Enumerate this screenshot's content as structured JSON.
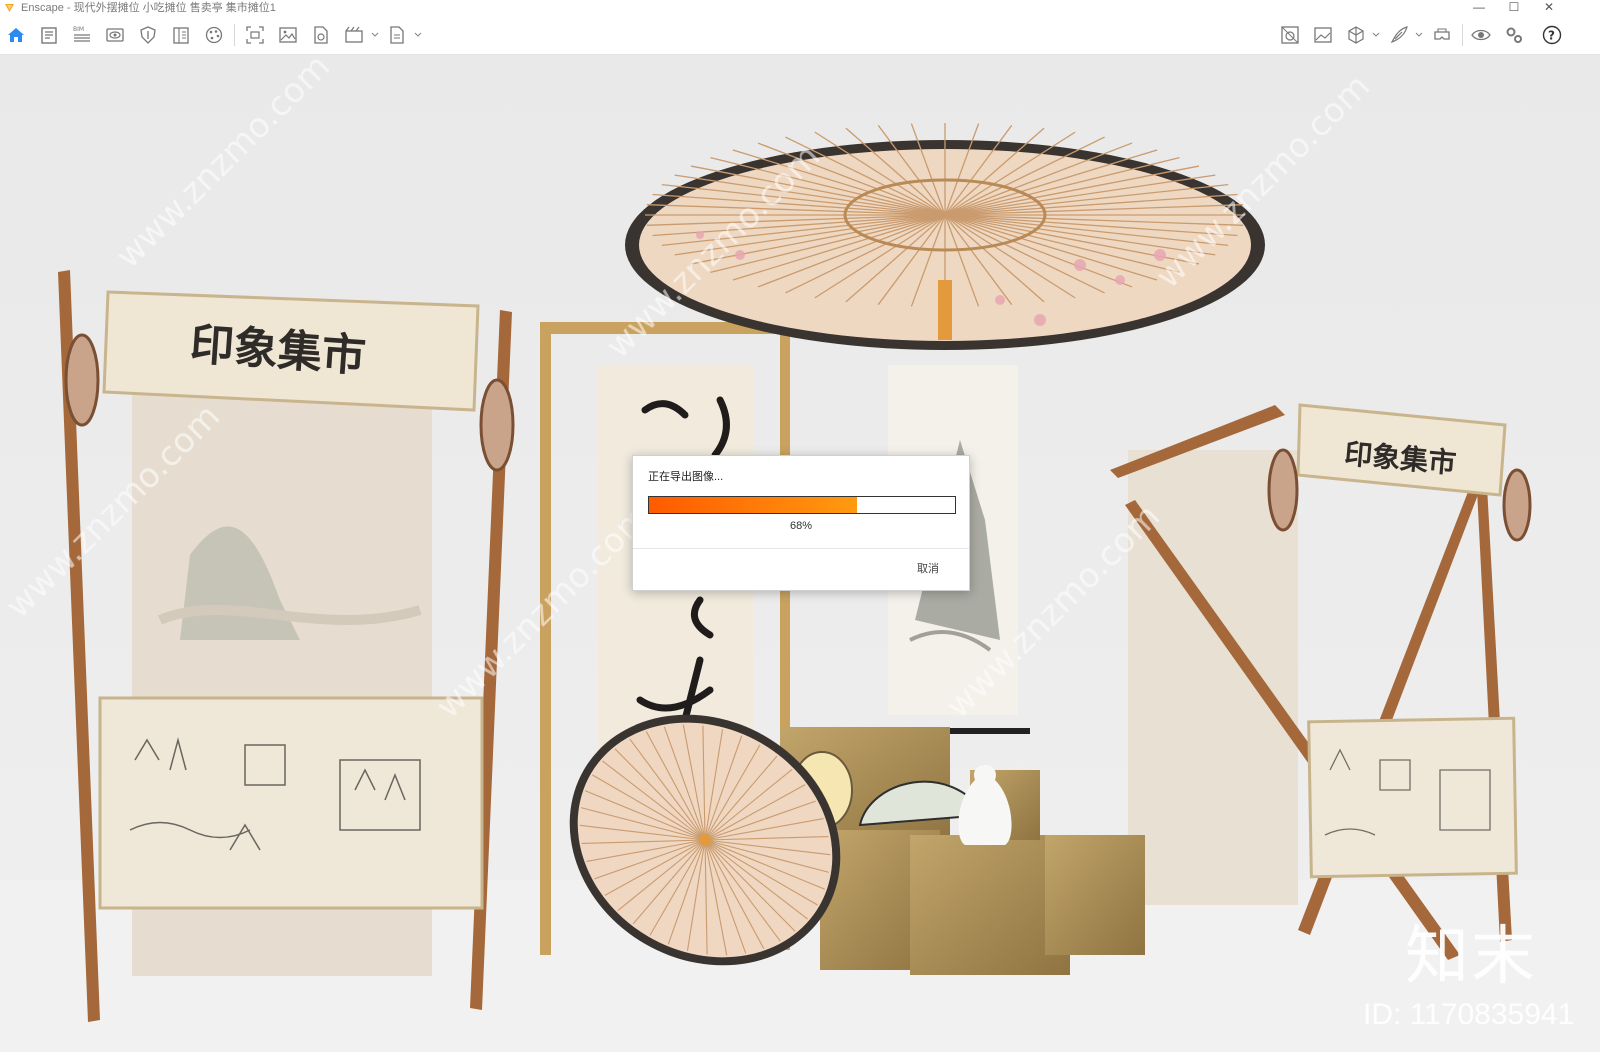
{
  "window": {
    "app_name": "Enscape",
    "title": "Enscape - 现代外摆摊位 小吃摊位 售卖亭 集市摊位1",
    "controls": {
      "minimize": "—",
      "maximize": "☐",
      "close": "✕"
    }
  },
  "toolbar": {
    "left_icons": [
      "home-icon",
      "document-icon",
      "bim-icon",
      "eye-view-icon",
      "shield-icon",
      "book-icon",
      "palette-icon",
      "screenshot-icon",
      "image-icon",
      "file-export-icon",
      "video-icon",
      "exe-export-icon"
    ],
    "bim_label": "BIM",
    "right_icons": [
      "asset-library-icon",
      "image-panel-icon",
      "cube-icon",
      "feather-icon",
      "vr-headset-icon",
      "eye-icon",
      "settings-icon",
      "help-icon"
    ],
    "help_label": "?"
  },
  "dialog": {
    "message": "正在导出图像...",
    "progress": 0.68,
    "percent_label": "68%",
    "cancel_label": "取消"
  },
  "scene": {
    "sign_text_left": "印象集市",
    "sign_text_right": "印象集市",
    "watermark": "www.znzmo.com",
    "brand_text": "知末",
    "id_text": "ID: 1170835941"
  },
  "colors": {
    "accent": "#1e88e5",
    "progress_start": "#ff5a00",
    "progress_end": "#ff9a10",
    "wood": "#a5683a",
    "umbrella_paper": "#efd8c2",
    "umbrella_rim": "#3a3431",
    "panel": "#e7ddcf"
  }
}
